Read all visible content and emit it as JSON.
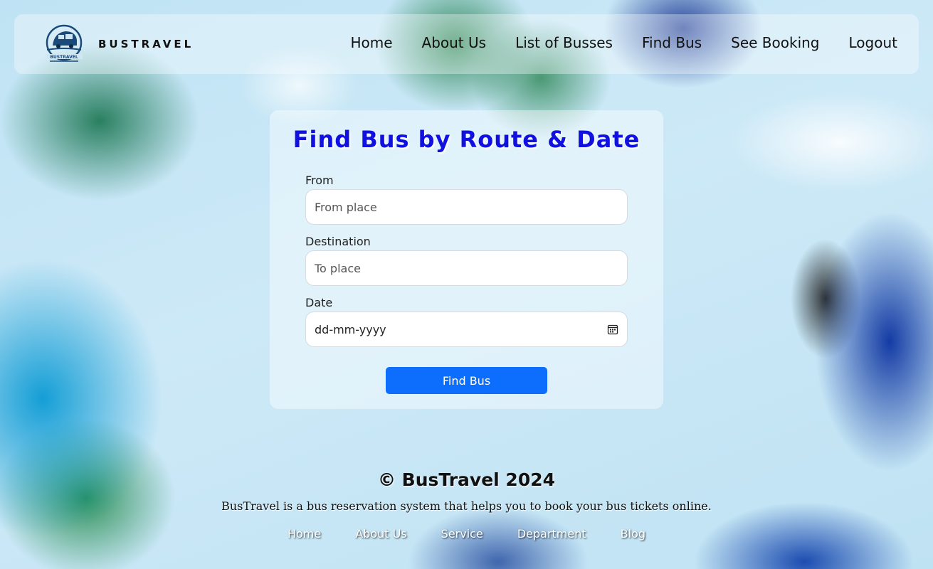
{
  "brand": {
    "name": "BUSTRAVEL",
    "logo_text": "BUSTRAVEL"
  },
  "nav": {
    "items": [
      {
        "label": "Home"
      },
      {
        "label": "About Us"
      },
      {
        "label": "List of Busses"
      },
      {
        "label": "Find Bus"
      },
      {
        "label": "See Booking"
      },
      {
        "label": "Logout"
      }
    ]
  },
  "form": {
    "title": "Find Bus by Route & Date",
    "from": {
      "label": "From",
      "placeholder": "From place",
      "value": ""
    },
    "destination": {
      "label": "Destination",
      "placeholder": "To place",
      "value": ""
    },
    "date": {
      "label": "Date",
      "placeholder": "dd-mm-yyyy",
      "icon": "calendar-icon"
    },
    "submit_label": "Find Bus"
  },
  "footer": {
    "title": "© BusTravel 2024",
    "description": "BusTravel is a bus reservation system that helps you to book your bus tickets online.",
    "links": [
      {
        "label": "Home"
      },
      {
        "label": "About Us"
      },
      {
        "label": "Service"
      },
      {
        "label": "Department"
      },
      {
        "label": "Blog"
      }
    ]
  },
  "colors": {
    "title": "#1010e0",
    "button": "#0d6efd",
    "logo": "#1a4a7a"
  }
}
